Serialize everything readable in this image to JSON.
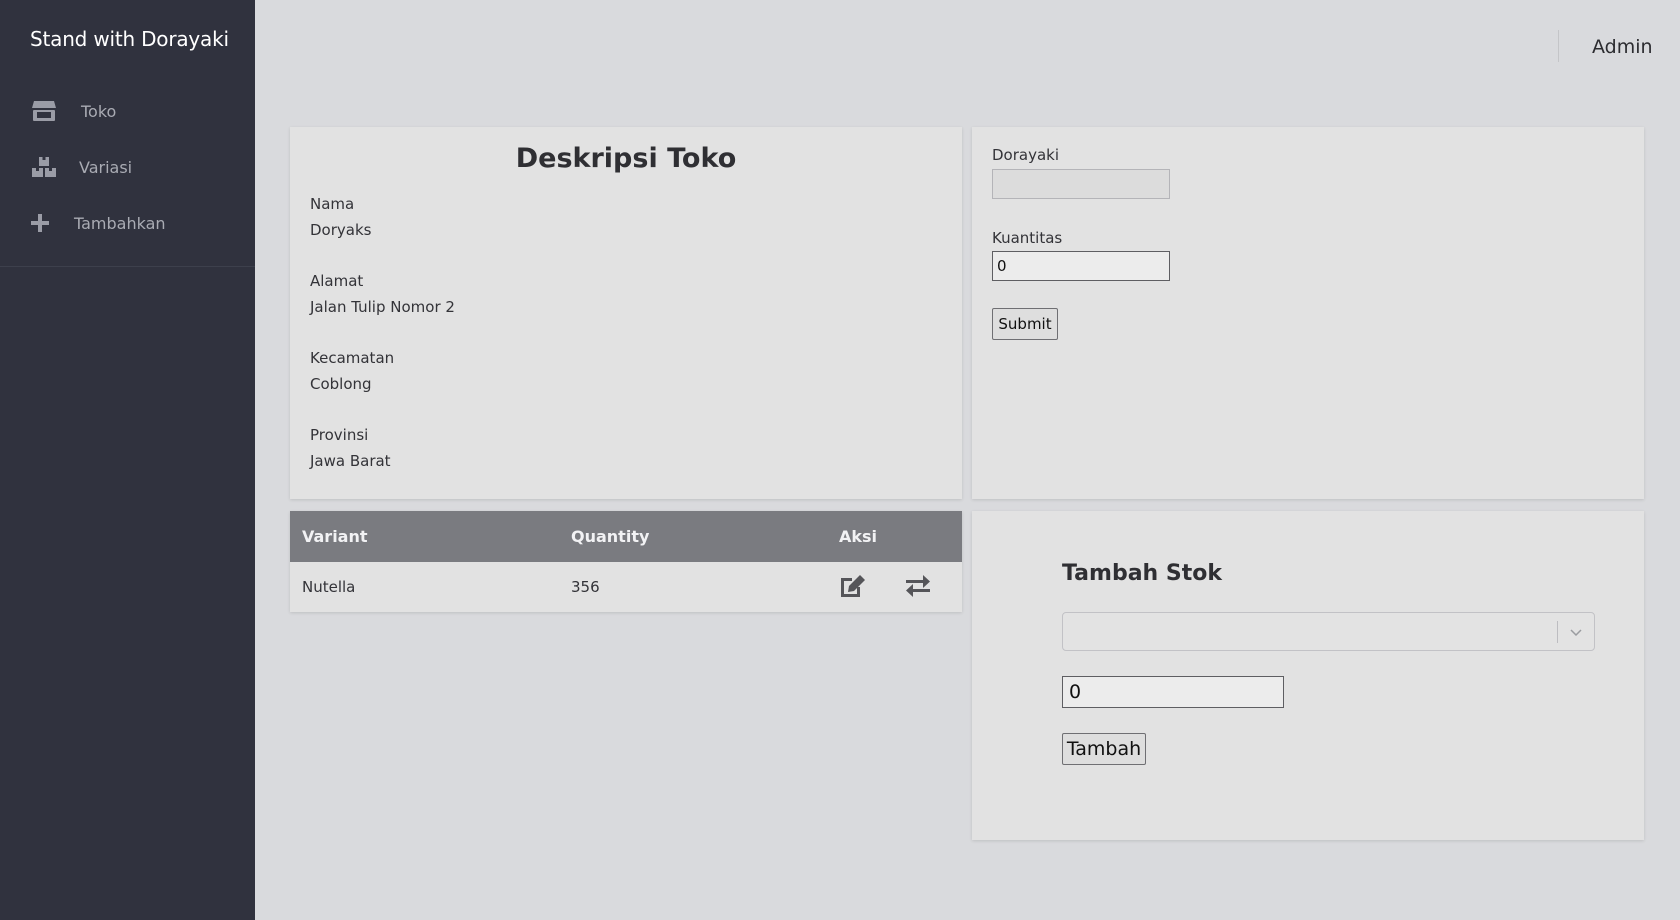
{
  "sidebar": {
    "brand": "Stand with Dorayaki",
    "items": [
      {
        "label": "Toko",
        "icon": "store-icon"
      },
      {
        "label": "Variasi",
        "icon": "boxes-icon"
      },
      {
        "label": "Tambahkan",
        "icon": "plus-icon"
      }
    ]
  },
  "header": {
    "user": "Admin"
  },
  "description": {
    "title": "Deskripsi Toko",
    "fields": [
      {
        "label": "Nama",
        "value": "Doryaks"
      },
      {
        "label": "Alamat",
        "value": "Jalan Tulip Nomor 2"
      },
      {
        "label": "Kecamatan",
        "value": "Coblong"
      },
      {
        "label": "Provinsi",
        "value": "Jawa Barat"
      }
    ]
  },
  "form": {
    "dorayaki_label": "Dorayaki",
    "dorayaki_value": "",
    "kuantitas_label": "Kuantitas",
    "kuantitas_value": "0",
    "submit_label": "Submit"
  },
  "table": {
    "headers": [
      "Variant",
      "Quantity",
      "Aksi"
    ],
    "rows": [
      {
        "variant": "Nutella",
        "quantity": "356",
        "actions": [
          "edit-icon",
          "transfer-icon"
        ]
      }
    ]
  },
  "tambah_stok": {
    "title": "Tambah Stok",
    "select_value": "",
    "quantity_value": "0",
    "button_label": "Tambah"
  },
  "colors": {
    "sidebar_bg": "#30323e",
    "page_bg": "#d9dadd",
    "card_bg": "#e2e2e2",
    "table_header_bg": "#7a7b80"
  }
}
